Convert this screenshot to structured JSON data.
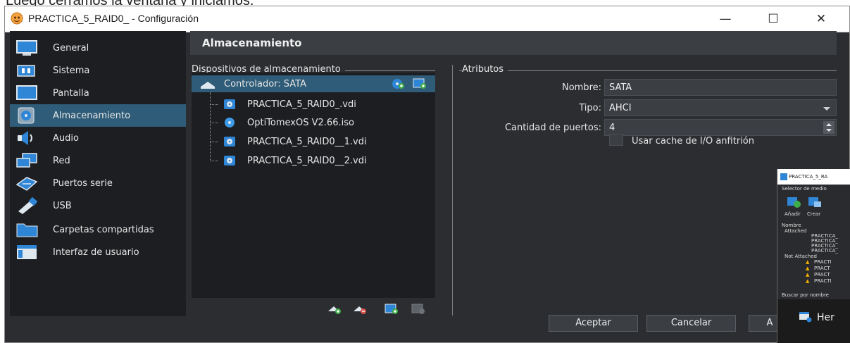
{
  "document_text": "Luego cerramos la ventana y iniciamos.",
  "window": {
    "title": "PRACTICA_5_RAID0_ - Configuración",
    "controls": {
      "minimize": "—",
      "maximize": "☐",
      "close": "✕"
    }
  },
  "sidebar": {
    "items": [
      {
        "label": "General",
        "icon": "monitor-icon"
      },
      {
        "label": "Sistema",
        "icon": "chip-icon"
      },
      {
        "label": "Pantalla",
        "icon": "display-icon"
      },
      {
        "label": "Almacenamiento",
        "icon": "disk-icon",
        "active": true
      },
      {
        "label": "Audio",
        "icon": "speaker-icon"
      },
      {
        "label": "Red",
        "icon": "network-icon"
      },
      {
        "label": "Puertos serie",
        "icon": "serial-port-icon"
      },
      {
        "label": "USB",
        "icon": "usb-icon"
      },
      {
        "label": "Carpetas compartidas",
        "icon": "folder-icon"
      },
      {
        "label": "Interfaz de usuario",
        "icon": "window-icon"
      }
    ]
  },
  "section": {
    "title": "Almacenamiento"
  },
  "storage": {
    "group_title": "Dispositivos de almacenamiento",
    "controller": "Controlador: SATA",
    "devices": [
      {
        "label": "PRACTICA_5_RAID0_.vdi",
        "icon": "hard-disk-icon"
      },
      {
        "label": "OptiTomexOS V2.66.iso",
        "icon": "optical-disc-icon"
      },
      {
        "label": "PRACTICA_5_RAID0__1.vdi",
        "icon": "hard-disk-icon"
      },
      {
        "label": "PRACTICA_5_RAID0__2.vdi",
        "icon": "hard-disk-icon"
      }
    ]
  },
  "attributes": {
    "group_title": "Atributos",
    "name_label": "Nombre:",
    "name_value": "SATA",
    "type_label": "Tipo:",
    "type_value": "AHCI",
    "ports_label": "Cantidad de puertos:",
    "ports_value": "4",
    "cache_label": "Usar cache de I/O anfitrión"
  },
  "buttons": {
    "accept": "Aceptar",
    "cancel": "Cancelar",
    "partial": "A"
  },
  "overlay": {
    "title": "PRACTICA_5_RA",
    "subtitle": "Selector de medio",
    "add": "Añadir",
    "create": "Crear",
    "col_name": "Nombre",
    "attached": "Attached",
    "attached_items": [
      "PRACTICA_",
      "PRACTICA_",
      "PRACTICA_",
      "PRACTICA_"
    ],
    "not_attached": "Not Attached",
    "not_attached_items": [
      "PRACTI",
      "PRACT",
      "PRACT",
      "PRACTI"
    ],
    "search": "Buscar por nombre",
    "taskbar_label": "Her"
  },
  "colors": {
    "selection": "#2f5c78",
    "panel": "#1d1e21",
    "window": "#2b2d30",
    "disk_blue": "#2f86d6",
    "add_green": "#3fae49"
  }
}
